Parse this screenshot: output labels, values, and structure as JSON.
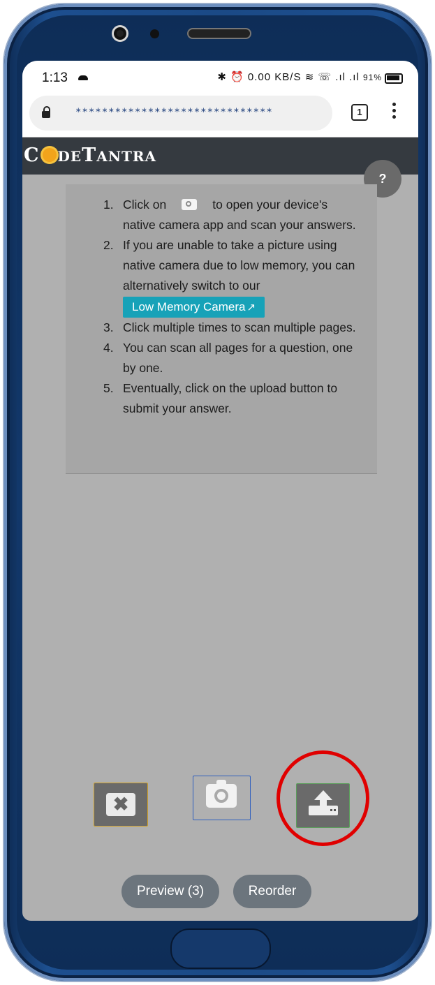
{
  "status_bar": {
    "time": "1:13",
    "icons_text": "✱ ⏰ 0.00 KB/S ≋ ☏ .ıl .ıl",
    "battery_percent": "91%"
  },
  "browser": {
    "url": "******************************",
    "tab_count": "1"
  },
  "brand": {
    "prefix": "C",
    "rest": "DE",
    "second": "T",
    "second_rest": "ANTRA"
  },
  "help": {
    "label": "?"
  },
  "instructions": {
    "step1_num": "1.",
    "step1_a": "Click on",
    "step1_b": "to open your device's native camera app and scan your answers.",
    "step2_num": "2.",
    "step2": "If you are unable to take a picture using native camera due to low memory, you can alternatively switch to our",
    "low_memory_label": "Low Memory Camera",
    "step3_num": "3.",
    "step3": "Click multiple times to scan multiple pages.",
    "step4_num": "4.",
    "step4": "You can scan all pages for a question, one by one.",
    "step5_num": "5.",
    "step5": "Eventually, click on the upload button to submit your answer."
  },
  "controls": {
    "discard_symbol": "✖"
  },
  "bottom": {
    "preview_label": "Preview (3)",
    "reorder_label": "Reorder"
  },
  "colors": {
    "accent_button": "#17a2b8",
    "pill_button": "#6c757d",
    "highlight_ring": "#e00000",
    "brand_bar": "#353a40"
  }
}
